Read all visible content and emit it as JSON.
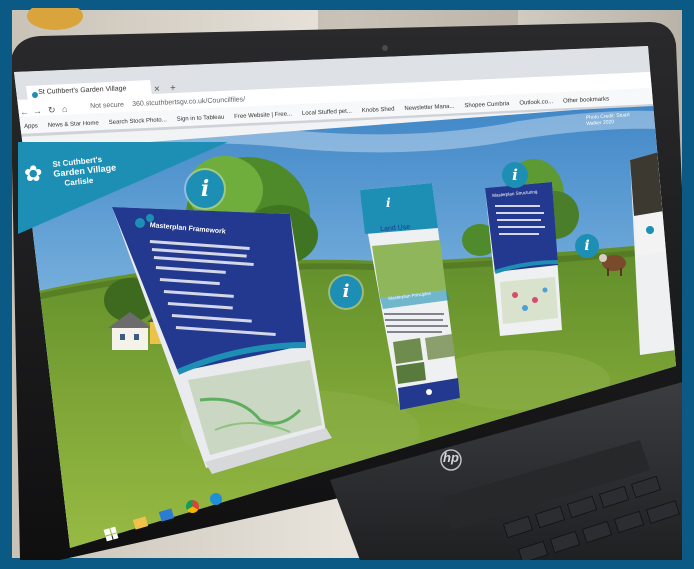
{
  "browser": {
    "tab_title": "St Cuthbert's Garden Village",
    "security_label": "Not secure",
    "url": "360.stcuthbertsgv.co.uk/Councilfiles/",
    "bookmarks": [
      "Apps",
      "News & Star Home",
      "Search Stock Photo...",
      "Sign in to Tableau",
      "Free Website | Free...",
      "Local Stuffed pet...",
      "Knobs Shed",
      "Newsletter Mana...",
      "Shopee Cumbria",
      "Outlook.co...",
      "Other bookmarks"
    ]
  },
  "tour": {
    "logo": {
      "line1": "St Cuthbert's",
      "line2": "Garden Village",
      "line3": "Carlisle"
    },
    "photo_credit": "Photo Credit: Stuart Walker 2020",
    "banner_left_title": "Masterplan Framework",
    "banner_center_title": "Land Use",
    "banner_center_subtitle": "Masterplan Principles",
    "banner_right_title": "Masterplan Structuring",
    "info_glyph": "i"
  },
  "laptop": {
    "brand": "hp"
  },
  "colors": {
    "frame": "#0b5a86",
    "banner_blue": "#23388f",
    "banner_teal": "#1d8fb5",
    "grass": "#6f9a2d",
    "sky": "#6aa7d6"
  },
  "icons": [
    "info-icon",
    "back-icon",
    "forward-icon",
    "reload-icon",
    "home-icon",
    "windows-start-icon",
    "chrome-icon",
    "edge-icon",
    "folder-icon",
    "mail-icon"
  ]
}
